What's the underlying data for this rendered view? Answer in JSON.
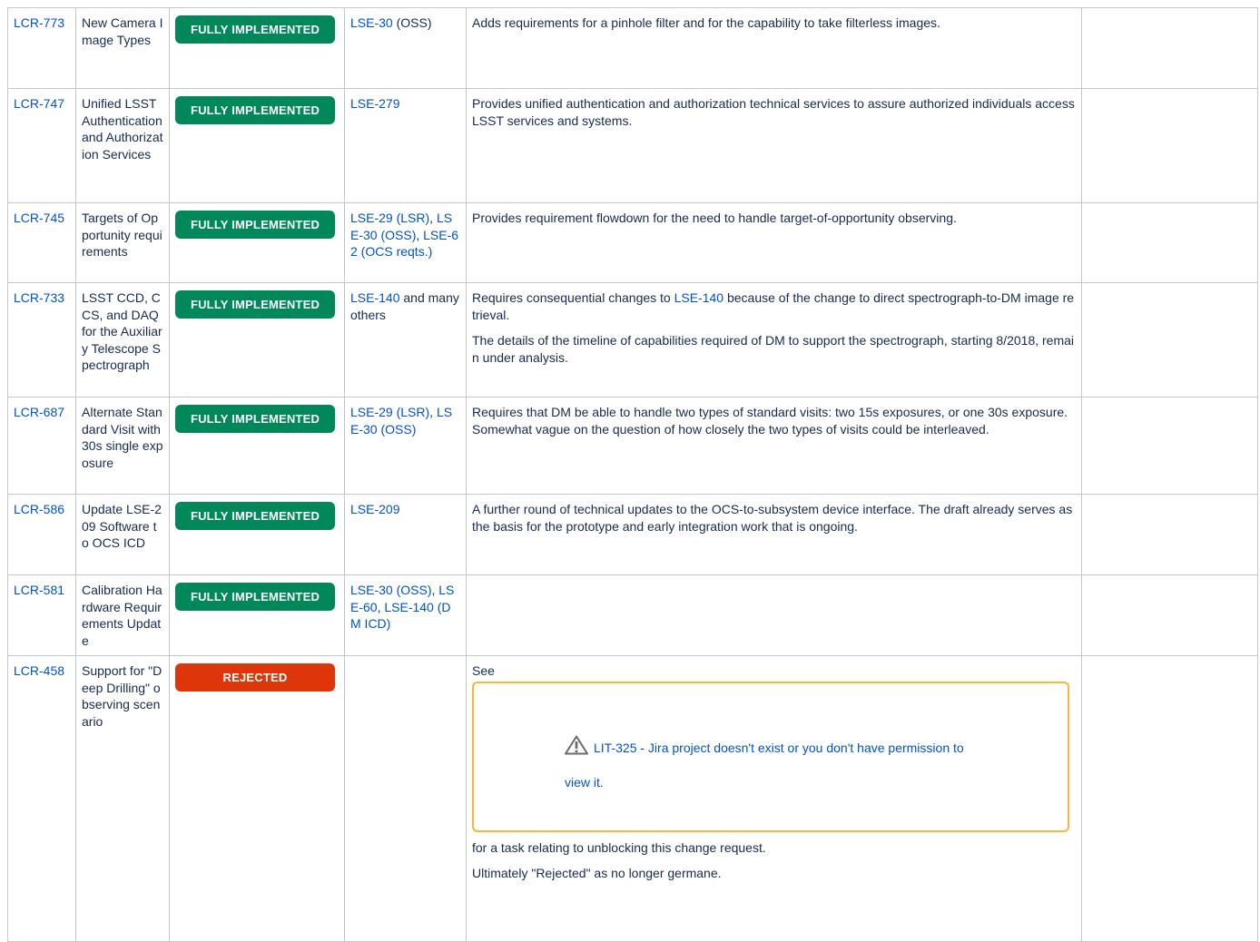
{
  "rows": [
    {
      "id_label": "LCR-773",
      "title": "New Camera Image Types",
      "status": "FULLY IMPLEMENTED",
      "docs": [
        {
          "text": "LSE-30",
          "link": true
        },
        {
          "text": " (OSS)",
          "link": false
        }
      ],
      "desc": [
        "Adds requirements for a pinhole filter and for the capability to take filterless images."
      ]
    },
    {
      "id_label": "LCR-747",
      "title": "Unified LSST Authentication and Authorization Services",
      "status": "FULLY IMPLEMENTED",
      "docs": [
        {
          "text": "LSE-279",
          "link": true
        }
      ],
      "desc": [
        "Provides unified authentication and authorization technical services to assure authorized individuals access LSST services and systems."
      ]
    },
    {
      "id_label": "LCR-745",
      "title": "Targets of Opportunity requirements",
      "status": "FULLY IMPLEMENTED",
      "docs": [
        {
          "text": "LSE-29 (LSR)",
          "link": true
        },
        {
          "text": ", ",
          "link": false
        },
        {
          "text": "LSE-30 (OSS)",
          "link": true
        },
        {
          "text": ", ",
          "link": false
        },
        {
          "text": "LSE-62 (OCS reqts.)",
          "link": true
        }
      ],
      "desc": [
        "Provides requirement flowdown for the need to handle target-of-opportunity observing."
      ]
    },
    {
      "id_label": "LCR-733",
      "title": "LSST CCD, CCS, and DAQ for the Auxiliary Telescope Spectrograph",
      "status": "FULLY IMPLEMENTED",
      "docs": [
        {
          "text": "LSE-140",
          "link": true
        },
        {
          "text": " and many others",
          "link": false
        }
      ],
      "desc_p1_pre": "Requires consequential changes to ",
      "desc_p1_link": "LSE-140",
      "desc_p1_post": " because of the change to direct spectrograph-to-DM image retrieval.",
      "desc_p2": "The details of the timeline of capabilities required of DM to support the spectrograph, starting 8/2018, remain under analysis."
    },
    {
      "id_label": "LCR-687",
      "title": "Alternate Standard Visit with 30s single exposure",
      "status": "FULLY IMPLEMENTED",
      "docs": [
        {
          "text": "LSE-29 (LSR)",
          "link": true
        },
        {
          "text": ", ",
          "link": false
        },
        {
          "text": "LSE-30 (OSS)",
          "link": true
        }
      ],
      "desc": [
        "Requires that DM be able to handle two types of standard visits: two 15s exposures, or one 30s exposure. Somewhat vague on the question of how closely the two types of visits could be interleaved."
      ]
    },
    {
      "id_label": "LCR-586",
      "title": "Update LSE-209 Software to OCS ICD",
      "status": "FULLY IMPLEMENTED",
      "docs": [
        {
          "text": "LSE-209",
          "link": true
        }
      ],
      "desc": [
        "A further round of technical updates to the OCS-to-subsystem device interface. The draft already serves as the basis for the prototype and early integration work that is ongoing."
      ]
    },
    {
      "id_label": "LCR-581",
      "title": "Calibration Hardware Requirements Update",
      "status": "FULLY IMPLEMENTED",
      "docs": [
        {
          "text": "LSE-30 (OSS)",
          "link": true
        },
        {
          "text": ", ",
          "link": false
        },
        {
          "text": "LSE-60",
          "link": true
        },
        {
          "text": ", ",
          "link": false
        },
        {
          "text": "LSE-140 (DM ICD)",
          "link": true
        }
      ],
      "desc": []
    },
    {
      "id_label": "LCR-458",
      "title": "Support for \"Deep Drilling\" observing scenario",
      "status": "REJECTED",
      "docs": [],
      "desc_see": "See",
      "jira_key": "LIT-325",
      "jira_msg": " - Jira project doesn't exist or you don't have permission to",
      "jira_msg2": "view it.",
      "desc_after": "for a task relating to unblocking this change request.",
      "desc_final": "Ultimately \"Rejected\" as no longer germane."
    }
  ],
  "colors": {
    "link": "#0052cc",
    "implemented": "#00875a",
    "rejected": "#de350b",
    "warning_border": "#f6b73c",
    "grid": "#c1c7d0"
  },
  "icons": {
    "warning": "warning-triangle-icon"
  }
}
